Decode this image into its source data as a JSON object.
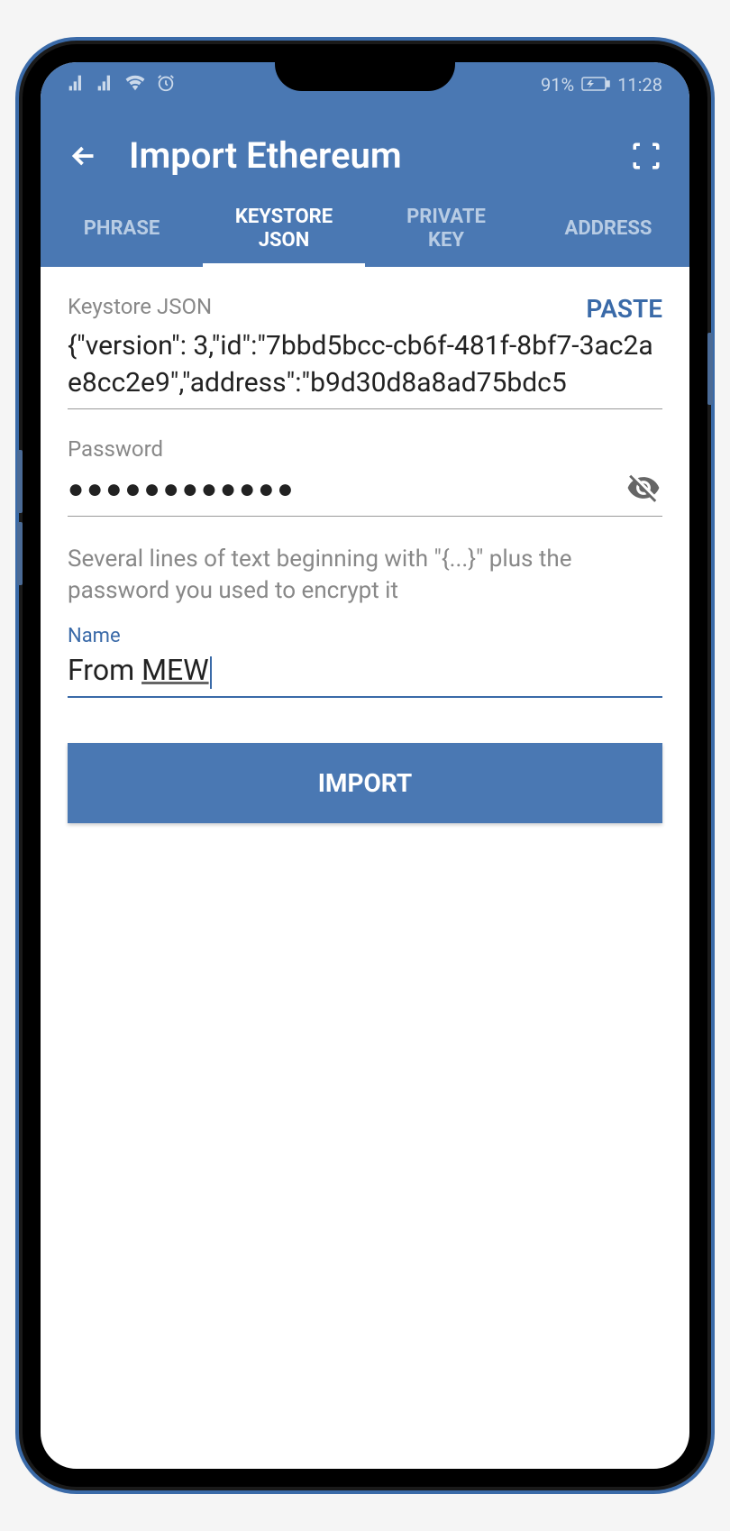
{
  "statusbar": {
    "battery_pct": "91%",
    "time": "11:28"
  },
  "header": {
    "title": "Import Ethereum"
  },
  "tabs": [
    {
      "label": "PHRASE"
    },
    {
      "label": "KEYSTORE\nJSON"
    },
    {
      "label": "PRIVATE\nKEY"
    },
    {
      "label": "ADDRESS"
    }
  ],
  "keystore": {
    "label": "Keystore JSON",
    "paste": "PASTE",
    "value": "{\"version\": 3,\"id\":\"7bbd5bcc-cb6f-481f-8bf7-3ac2ae8cc2e9\",\"address\":\"b9d30d8a8ad75bdc5"
  },
  "password": {
    "label": "Password",
    "mask": "●●●●●●●●●●●●"
  },
  "helper": "Several lines of text beginning with \"{...}\" plus the password you used to encrypt it",
  "name": {
    "label": "Name",
    "prefix": "From ",
    "value_underlined": "MEW"
  },
  "actions": {
    "import": "IMPORT"
  }
}
